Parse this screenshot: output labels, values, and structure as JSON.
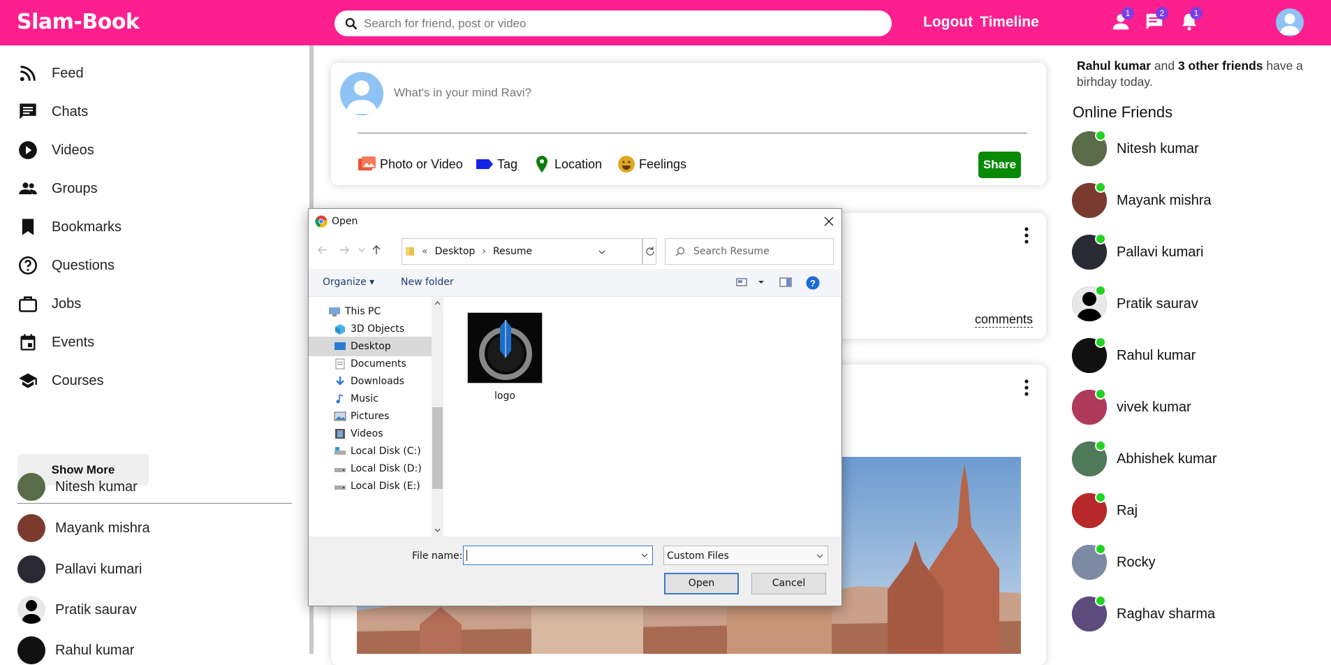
{
  "app": {
    "logo": "Slam-Book",
    "search_placeholder": "Search for friend, post or video",
    "logout": "Logout",
    "timeline": "Timeline",
    "friend_badge": "1",
    "chat_badge": "2",
    "notif_badge": "1",
    "brand_color": "#fd1f8f"
  },
  "sidebar": {
    "items": [
      {
        "label": "Feed",
        "icon": "rss-icon"
      },
      {
        "label": "Chats",
        "icon": "chat-icon"
      },
      {
        "label": "Videos",
        "icon": "play-circle-icon"
      },
      {
        "label": "Groups",
        "icon": "group-icon"
      },
      {
        "label": "Bookmarks",
        "icon": "bookmark-icon"
      },
      {
        "label": "Questions",
        "icon": "help-circle-icon"
      },
      {
        "label": "Jobs",
        "icon": "briefcase-icon"
      },
      {
        "label": "Events",
        "icon": "calendar-icon"
      },
      {
        "label": "Courses",
        "icon": "school-icon"
      }
    ],
    "show_more": "Show More",
    "friends": [
      "Nitesh kumar",
      "Mayank mishra",
      "Pallavi kumari",
      "Pratik saurav",
      "Rahul kumar"
    ]
  },
  "composer": {
    "placeholder": "What's in your mind Ravi?",
    "photo": "Photo or Video",
    "tag": "Tag",
    "location": "Location",
    "feelings": "Feelings",
    "share": "Share"
  },
  "post": {
    "comments": "comments"
  },
  "rightbar": {
    "bday_name": "Rahul kumar",
    "bday_and": " and ",
    "bday_others": "3 other friends",
    "bday_rest": " have a birhday today.",
    "online_title": "Online Friends",
    "friends": [
      "Nitesh kumar",
      "Mayank mishra",
      "Pallavi kumari",
      "Pratik saurav",
      "Rahul kumar",
      "vivek kumar",
      "Abhishek kumar",
      "Raj",
      "Rocky",
      "Raghav sharma"
    ]
  },
  "dialog": {
    "title": "Open",
    "breadcrumb_sep": "«",
    "crumb1": "Desktop",
    "crumb2": "Resume",
    "search_placeholder": "Search Resume",
    "organize": "Organize ▾",
    "new_folder": "New folder",
    "tree": [
      {
        "label": "This PC",
        "icon": "computer-icon"
      },
      {
        "label": "3D Objects",
        "icon": "cube-icon"
      },
      {
        "label": "Desktop",
        "icon": "desktop-icon",
        "selected": true
      },
      {
        "label": "Documents",
        "icon": "document-icon"
      },
      {
        "label": "Downloads",
        "icon": "download-icon"
      },
      {
        "label": "Music",
        "icon": "music-icon"
      },
      {
        "label": "Pictures",
        "icon": "picture-icon"
      },
      {
        "label": "Videos",
        "icon": "film-icon"
      },
      {
        "label": "Local Disk (C:)",
        "icon": "drive-icon"
      },
      {
        "label": "Local Disk (D:)",
        "icon": "drive-icon"
      },
      {
        "label": "Local Disk (E:)",
        "icon": "drive-icon"
      }
    ],
    "file_name": "logo",
    "file_name_label": "File name:",
    "file_name_value": "",
    "file_type": "Custom Files",
    "open": "Open",
    "cancel": "Cancel"
  }
}
